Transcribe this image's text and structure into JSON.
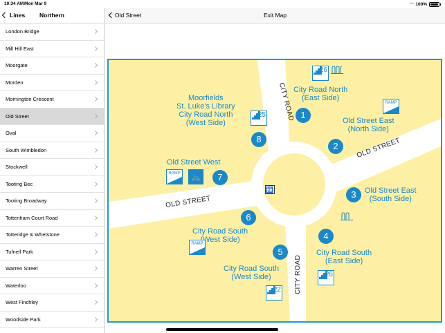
{
  "status_bar": {
    "time": "10:34 AM",
    "date": "Mon Mar 9",
    "battery": "100%"
  },
  "sidebar": {
    "back_label": "Lines",
    "title": "Northern",
    "stations": [
      "London Bridge",
      "Mill Hill East",
      "Moorgate",
      "Morden",
      "Mornington Crescent",
      "Old Street",
      "Oval",
      "South Wimbledon",
      "Stockwell",
      "Tooting Bec",
      "Tooting Broadway",
      "Tottenham Court Road",
      "Totteridge & Whetstone",
      "Tufnell Park",
      "Warren Street",
      "Waterloo",
      "West Finchley",
      "Woodside Park"
    ],
    "selected": "Old Street"
  },
  "main": {
    "back_label": "Old Street",
    "title": "Exit Map"
  },
  "map": {
    "roads": {
      "city_road_north": "CITY ROAD",
      "city_road_south": "CITY ROAD",
      "old_street_east": "OLD STREET",
      "old_street_west": "OLD STREET"
    },
    "exits": [
      {
        "number": "1",
        "label_1": "City Road North",
        "label_2": "(East Side)"
      },
      {
        "number": "2",
        "label_1": "Old Street East",
        "label_2": "(North Side)"
      },
      {
        "number": "3",
        "label_1": "Old Street East",
        "label_2": "(South Side)"
      },
      {
        "number": "4",
        "label_1": "City Road South",
        "label_2": "(East Side)"
      },
      {
        "number": "5",
        "label_1": "City Road South",
        "label_2": "(West Side)"
      },
      {
        "number": "6",
        "label_1": "City Road South",
        "label_2": "(West  Side)"
      },
      {
        "number": "7",
        "label_1": "Old Street West",
        "label_2": ""
      },
      {
        "number": "8",
        "label_1": "Moorfields",
        "label_2": "St. Luke's Library",
        "label_3": "City Road North",
        "label_4": "(West Side)"
      }
    ],
    "stairs": {
      "exit1": "26",
      "exit8": "25",
      "exit5": "22",
      "exit4": "26"
    },
    "ramp_label": "RAMP",
    "colors": {
      "map_bg": "#fdf0a4",
      "road": "#ffffff",
      "accent": "#1a88c9",
      "border": "#1a9bd7"
    }
  }
}
